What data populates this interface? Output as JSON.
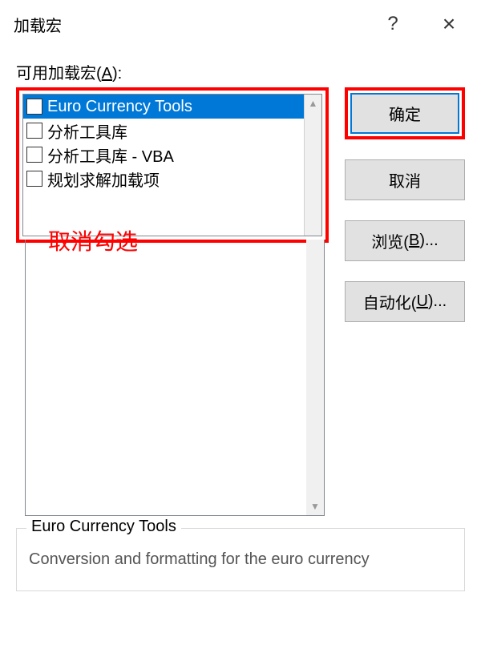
{
  "titlebar": {
    "title": "加载宏",
    "help": "?",
    "close": "×"
  },
  "label": {
    "text_prefix": "可用加载宏(",
    "mnemonic": "A",
    "text_suffix": "):"
  },
  "list": {
    "items": [
      {
        "label": "Euro Currency Tools",
        "selected": true
      },
      {
        "label": "分析工具库",
        "selected": false
      },
      {
        "label": "分析工具库 - VBA",
        "selected": false
      },
      {
        "label": "规划求解加载项",
        "selected": false
      }
    ]
  },
  "annotation": "取消勾选",
  "buttons": {
    "ok": "确定",
    "cancel": "取消",
    "browse_prefix": "浏览(",
    "browse_m": "B",
    "browse_suffix": ")...",
    "auto_prefix": "自动化(",
    "auto_m": "U",
    "auto_suffix": ")..."
  },
  "description": {
    "title": "Euro Currency Tools",
    "text": "Conversion and formatting for the euro currency"
  }
}
